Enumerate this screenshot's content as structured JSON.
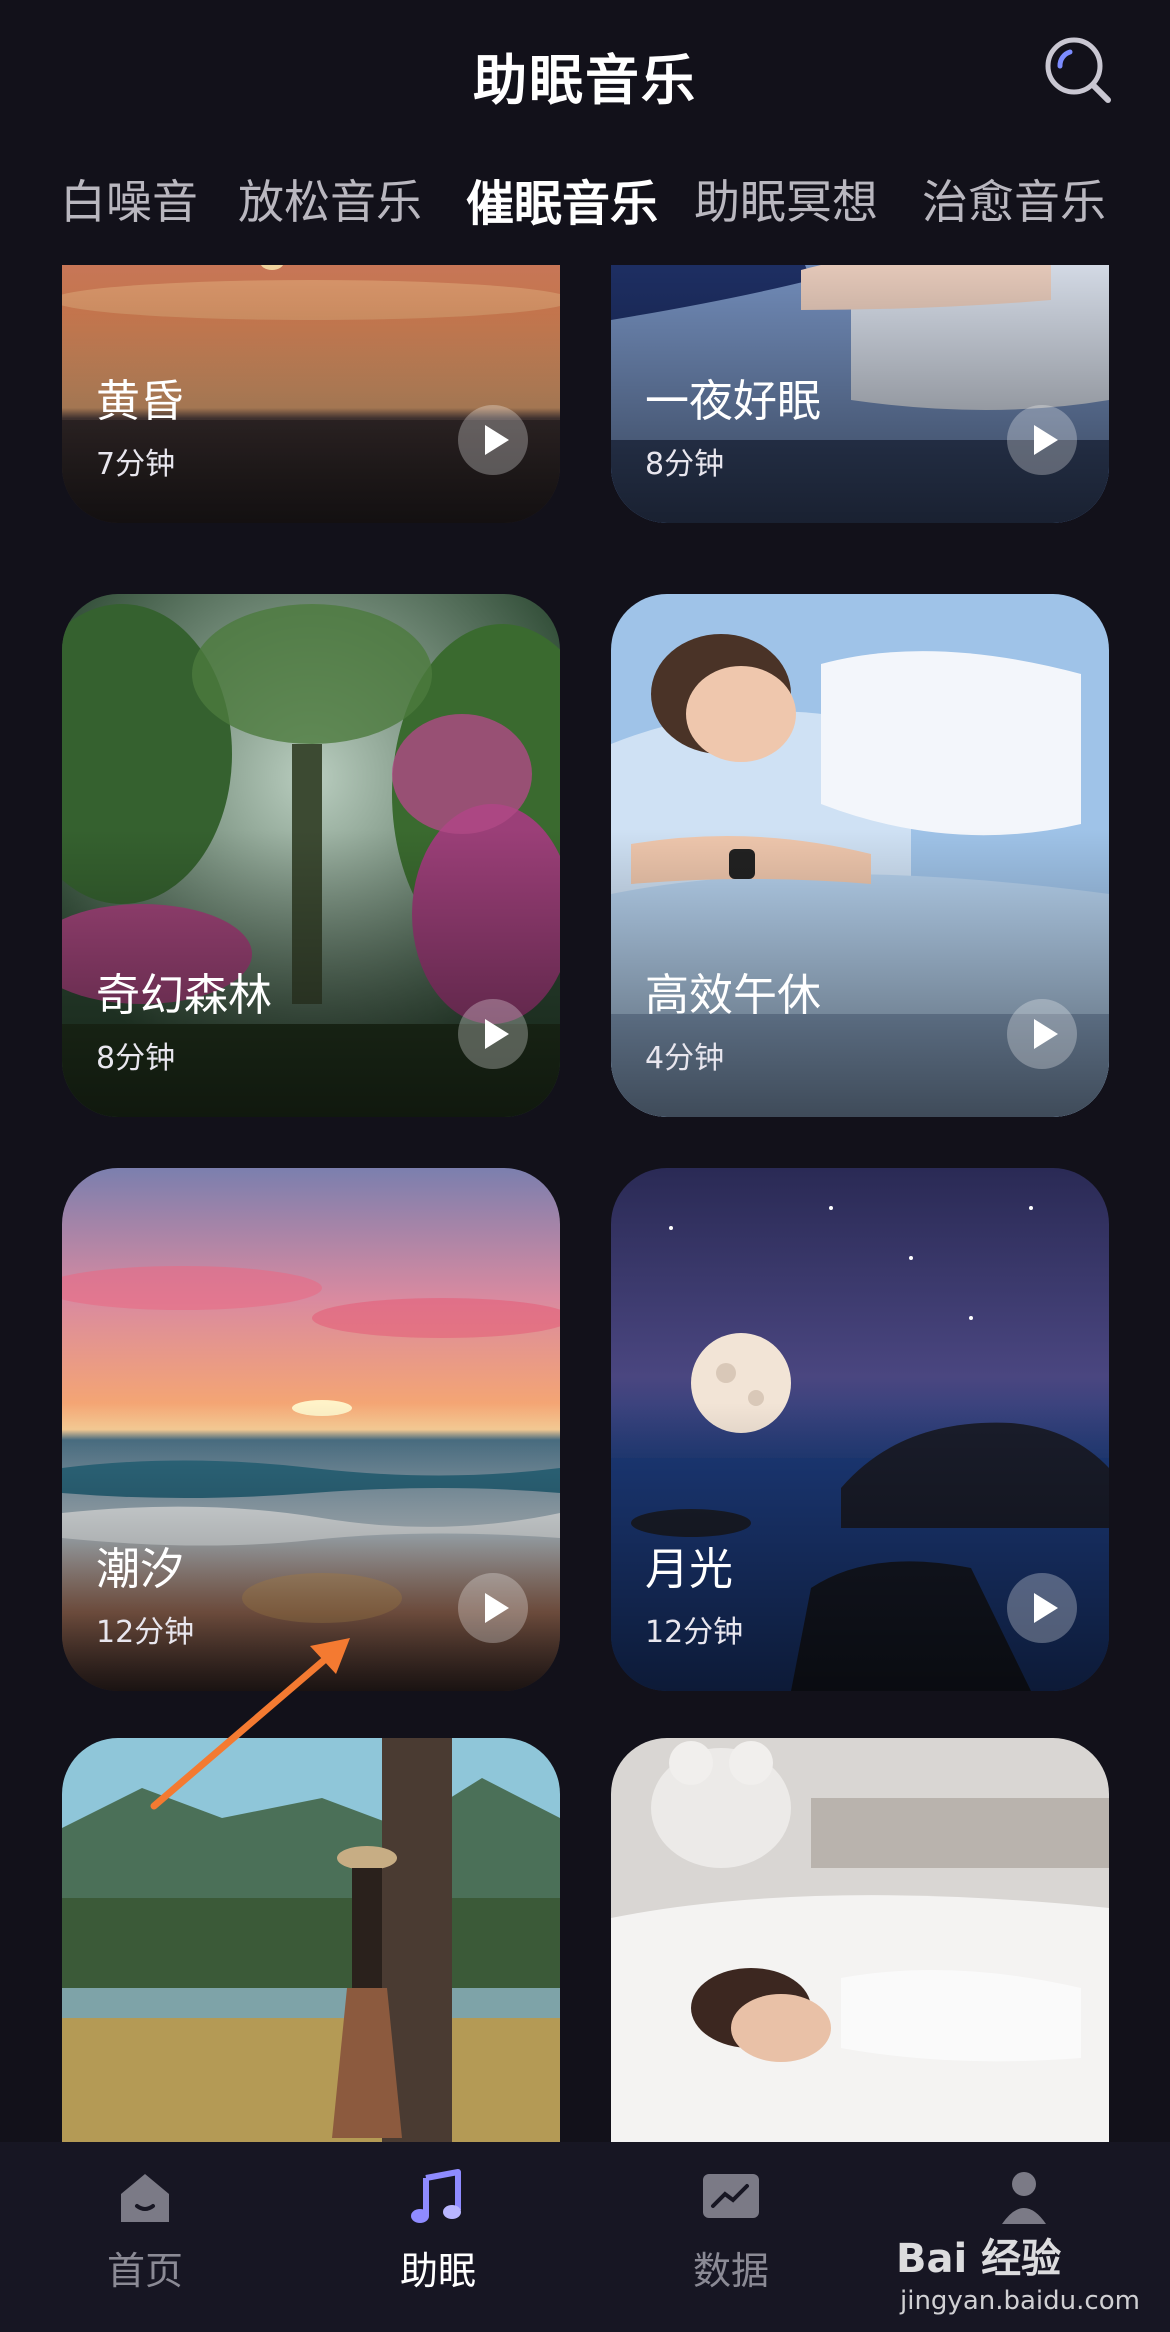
{
  "header": {
    "title": "助眠音乐"
  },
  "tabs": [
    {
      "label": "白噪音",
      "active": false
    },
    {
      "label": "放松音乐",
      "active": false
    },
    {
      "label": "催眠音乐",
      "active": true
    },
    {
      "label": "助眠冥想",
      "active": false
    },
    {
      "label": "治愈音乐",
      "active": false
    }
  ],
  "cards": [
    {
      "title": "黄昏",
      "duration": "7分钟",
      "image": "sunset-over-sea"
    },
    {
      "title": "一夜好眠",
      "duration": "8分钟",
      "image": "sleeping-person-blue-bedding"
    },
    {
      "title": "奇幻森林",
      "duration": "8分钟",
      "image": "fantasy-forest"
    },
    {
      "title": "高效午休",
      "duration": "4分钟",
      "image": "woman-napping-on-pillow"
    },
    {
      "title": "潮汐",
      "duration": "12分钟",
      "image": "tide-beach-sunset"
    },
    {
      "title": "月光",
      "duration": "12分钟",
      "image": "full-moon-over-sea"
    },
    {
      "title": "",
      "duration": "",
      "image": "woman-with-hat-by-lake"
    },
    {
      "title": "",
      "duration": "",
      "image": "woman-sleeping-white-bed"
    }
  ],
  "bottom_nav": [
    {
      "label": "首页",
      "icon": "home-icon",
      "active": false
    },
    {
      "label": "助眠",
      "icon": "music-note-icon",
      "active": true
    },
    {
      "label": "数据",
      "icon": "chart-icon",
      "active": false
    },
    {
      "label": "",
      "icon": "profile-icon",
      "active": false
    }
  ],
  "watermark": {
    "main": "Bai 经验",
    "sub": "jingyan.baidu.com"
  },
  "colors": {
    "background": "#12111a",
    "nav_background": "#171623",
    "active_icon": "#8f8bff",
    "arrow": "#f47a31"
  }
}
